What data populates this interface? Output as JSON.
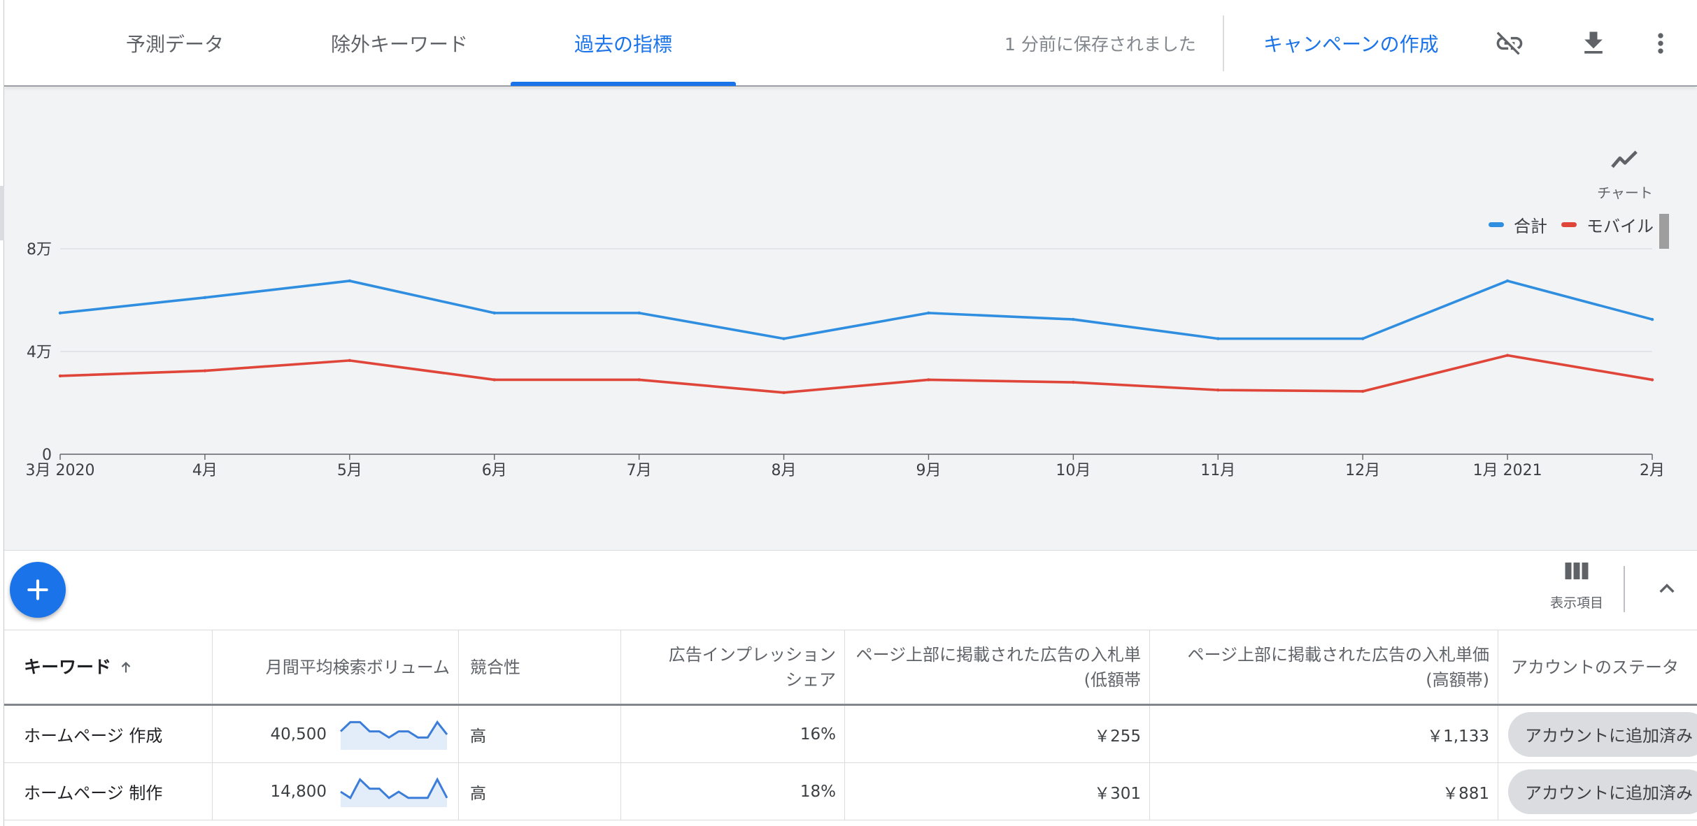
{
  "header": {
    "tabs": [
      {
        "label": "予測データ"
      },
      {
        "label": "除外キーワード"
      },
      {
        "label": "過去の指標"
      }
    ],
    "active_tab": 2,
    "saved_status": "1 分前に保存されました",
    "create_campaign": "キャンペーンの作成",
    "icons": [
      "link-off-icon",
      "download-icon",
      "more-vert-icon"
    ]
  },
  "chart_panel": {
    "toggle_label": "チャート",
    "toggle_icon": "line-chart-icon"
  },
  "chart_data": {
    "type": "line",
    "x": [
      "3月 2020",
      "4月",
      "5月",
      "6月",
      "7月",
      "8月",
      "9月",
      "10月",
      "11月",
      "12月",
      "1月 2021",
      "2月"
    ],
    "y_ticks": [
      "0",
      "4万",
      "8万"
    ],
    "ylim": [
      0,
      80000
    ],
    "grid": true,
    "legend_position": "top-right",
    "series": [
      {
        "name": "合計",
        "color": "#2f8ee0",
        "values": [
          55000,
          61000,
          67500,
          55000,
          55000,
          45000,
          55000,
          52500,
          45000,
          45000,
          67500,
          52500
        ]
      },
      {
        "name": "モバイル",
        "color": "#e0453a",
        "values": [
          30500,
          32500,
          36500,
          29000,
          29000,
          24000,
          29000,
          28000,
          25000,
          24500,
          38500,
          29000
        ]
      }
    ]
  },
  "toolbar": {
    "add_icon": "add-icon",
    "columns_label": "表示項目",
    "columns_icon": "columns-icon",
    "collapse_icon": "chevron-up-icon"
  },
  "table": {
    "headers": {
      "keyword": "キーワード",
      "volume": "月間平均検索ボリューム",
      "competition": "競合性",
      "impression_share_1": "広告インプレッション",
      "impression_share_2": "シェア",
      "bid_low_1": "ページ上部に掲載された広告の入札単",
      "bid_low_2": "(低額帯",
      "bid_high_1": "ページ上部に掲載された広告の入札単価",
      "bid_high_2": "(高額帯)",
      "status": "アカウントのステータ"
    },
    "rows": [
      {
        "keyword": "ホームページ 作成",
        "volume": "40,500",
        "trend": [
          6,
          9,
          9,
          6,
          6,
          4,
          6,
          6,
          4,
          4,
          9,
          5
        ],
        "competition": "高",
        "impression_share": "16%",
        "bid_low": "￥255",
        "bid_high": "￥1,133",
        "status": "アカウントに追加済み"
      },
      {
        "keyword": "ホームページ 制作",
        "volume": "14,800",
        "trend": [
          5,
          3,
          9,
          6,
          6,
          3,
          5,
          3,
          3,
          3,
          9,
          3
        ],
        "competition": "高",
        "impression_share": "18%",
        "bid_low": "￥301",
        "bid_high": "￥881",
        "status": "アカウントに追加済み"
      }
    ]
  }
}
